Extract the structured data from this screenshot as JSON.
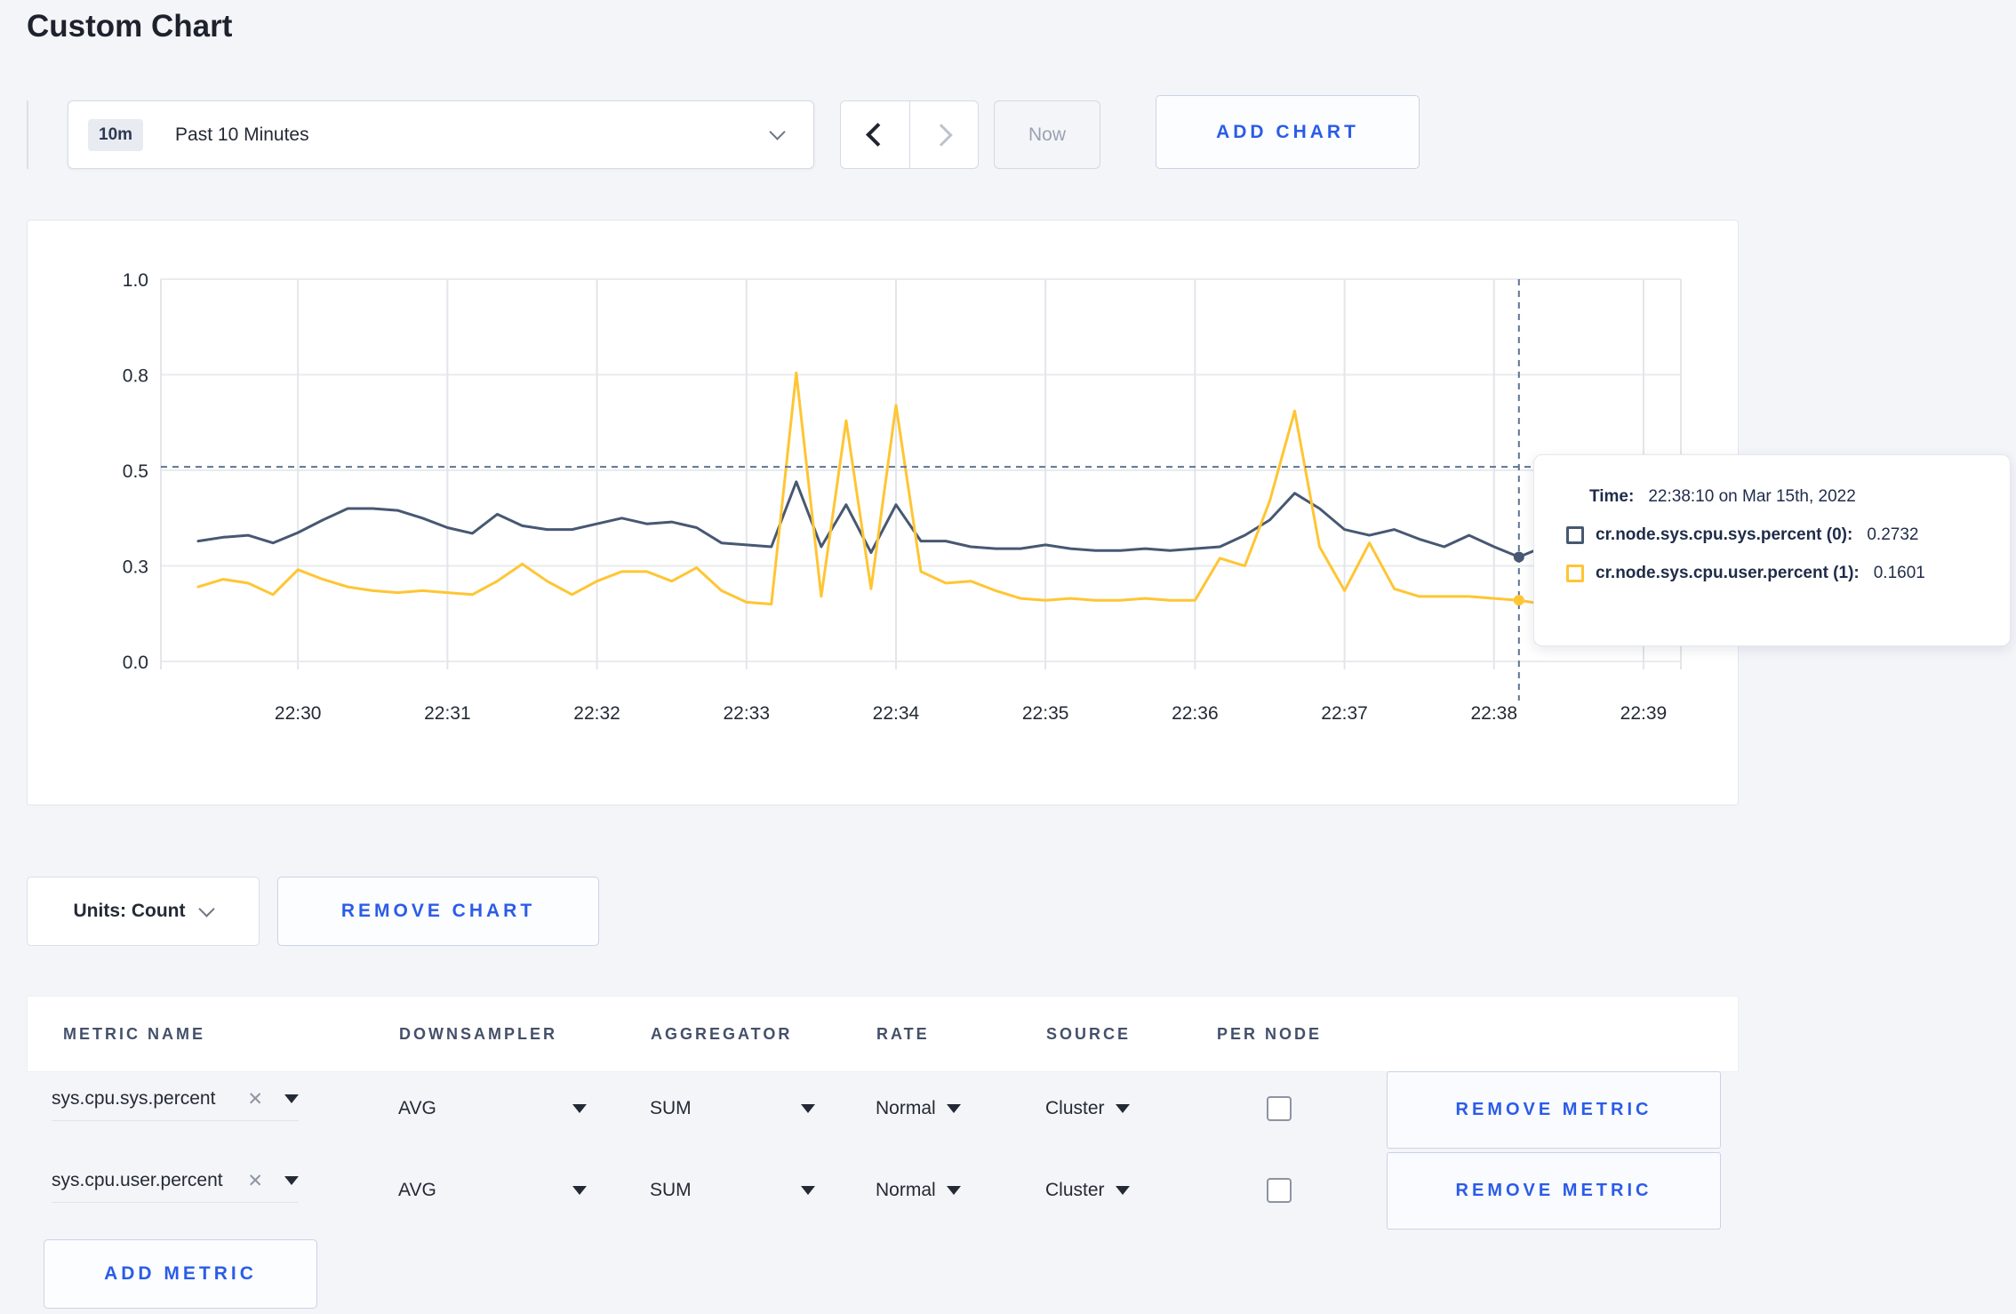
{
  "page": {
    "title": "Custom Chart",
    "accent_blue": "#2b5ce8",
    "background": "#f4f5f9"
  },
  "toolbar": {
    "time_badge": "10m",
    "time_label": "Past 10 Minutes",
    "now_label": "Now",
    "add_chart_label": "ADD CHART"
  },
  "icons": {
    "clear_x": "✕"
  },
  "chart_data": {
    "type": "line",
    "title": "",
    "xlabel": "",
    "ylabel": "",
    "grid": true,
    "legend_position": "tooltip",
    "y_domain": [
      0,
      1
    ],
    "y_ticks": [
      {
        "v": 0,
        "label": "0.0"
      },
      {
        "v": 0.25,
        "label": "0.3"
      },
      {
        "v": 0.5,
        "label": "0.5"
      },
      {
        "v": 0.75,
        "label": "0.8"
      },
      {
        "v": 1,
        "label": "1.0"
      }
    ],
    "x_domain_seconds": [
      -55,
      555
    ],
    "x_ticks": [
      {
        "t": 0,
        "label": "22:30"
      },
      {
        "t": 60,
        "label": "22:31"
      },
      {
        "t": 120,
        "label": "22:32"
      },
      {
        "t": 180,
        "label": "22:33"
      },
      {
        "t": 240,
        "label": "22:34"
      },
      {
        "t": 300,
        "label": "22:35"
      },
      {
        "t": 360,
        "label": "22:36"
      },
      {
        "t": 420,
        "label": "22:37"
      },
      {
        "t": 480,
        "label": "22:38"
      },
      {
        "t": 540,
        "label": "22:39"
      }
    ],
    "sample_start_seconds": -40,
    "sample_interval_seconds": 10,
    "series": [
      {
        "name": "cr.node.sys.cpu.sys.percent",
        "color": "#475872",
        "values": [
          0.315,
          0.325,
          0.33,
          0.31,
          0.337,
          0.37,
          0.4,
          0.4,
          0.395,
          0.375,
          0.35,
          0.335,
          0.385,
          0.355,
          0.345,
          0.345,
          0.36,
          0.375,
          0.36,
          0.365,
          0.35,
          0.31,
          0.305,
          0.3,
          0.47,
          0.3,
          0.41,
          0.285,
          0.41,
          0.315,
          0.315,
          0.3,
          0.295,
          0.295,
          0.305,
          0.295,
          0.29,
          0.29,
          0.295,
          0.29,
          0.295,
          0.3,
          0.33,
          0.37,
          0.44,
          0.4,
          0.345,
          0.33,
          0.345,
          0.32,
          0.3,
          0.33,
          0.3,
          0.2732,
          0.3,
          0.295,
          0.3,
          0.3,
          0.295,
          0.3
        ]
      },
      {
        "name": "cr.node.sys.cpu.user.percent",
        "color": "#ffc533",
        "values": [
          0.195,
          0.215,
          0.205,
          0.175,
          0.24,
          0.215,
          0.195,
          0.185,
          0.18,
          0.185,
          0.18,
          0.175,
          0.21,
          0.255,
          0.21,
          0.175,
          0.21,
          0.235,
          0.235,
          0.21,
          0.245,
          0.185,
          0.155,
          0.15,
          0.755,
          0.17,
          0.63,
          0.19,
          0.67,
          0.235,
          0.205,
          0.21,
          0.185,
          0.165,
          0.16,
          0.165,
          0.16,
          0.16,
          0.165,
          0.16,
          0.16,
          0.27,
          0.25,
          0.42,
          0.655,
          0.3,
          0.185,
          0.31,
          0.19,
          0.17,
          0.17,
          0.17,
          0.165,
          0.1601,
          0.15,
          0.15,
          0.19,
          0.27,
          0.255,
          0.24
        ]
      }
    ],
    "crosshair": {
      "time": "22:38:10",
      "t_seconds": 490,
      "hline_value": 0.509,
      "point_values": [
        0.2732,
        0.1601
      ]
    }
  },
  "tooltip": {
    "time_label": "Time:",
    "time_value": "22:38:10 on Mar 15th, 2022",
    "rows": [
      {
        "name": "cr.node.sys.cpu.sys.percent (0):",
        "value": "0.2732",
        "color": "#475872"
      },
      {
        "name": "cr.node.sys.cpu.user.percent (1):",
        "value": "0.1601",
        "color": "#ffc533"
      }
    ]
  },
  "controls": {
    "units_label": "Units: Count",
    "remove_chart_label": "REMOVE CHART"
  },
  "metrics_table": {
    "columns": [
      "METRIC NAME",
      "DOWNSAMPLER",
      "AGGREGATOR",
      "RATE",
      "SOURCE",
      "PER NODE"
    ],
    "rows": [
      {
        "metric": "sys.cpu.sys.percent",
        "downsampler": "AVG",
        "aggregator": "SUM",
        "rate": "Normal",
        "source": "Cluster",
        "per_node_checked": false,
        "remove_label": "REMOVE METRIC"
      },
      {
        "metric": "sys.cpu.user.percent",
        "downsampler": "AVG",
        "aggregator": "SUM",
        "rate": "Normal",
        "source": "Cluster",
        "per_node_checked": false,
        "remove_label": "REMOVE METRIC"
      }
    ],
    "add_metric_label": "ADD METRIC"
  }
}
